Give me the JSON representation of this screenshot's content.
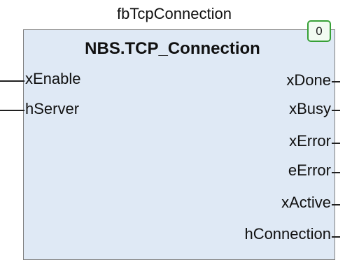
{
  "block": {
    "instance_name": "fbTcpConnection",
    "type_name": "NBS.TCP_Connection",
    "execution_order": "0"
  },
  "inputs": [
    {
      "label": "xEnable"
    },
    {
      "label": "hServer"
    }
  ],
  "outputs": [
    {
      "label": "xDone"
    },
    {
      "label": "xBusy"
    },
    {
      "label": "xError"
    },
    {
      "label": "eError"
    },
    {
      "label": "xActive"
    },
    {
      "label": "hConnection"
    }
  ]
}
